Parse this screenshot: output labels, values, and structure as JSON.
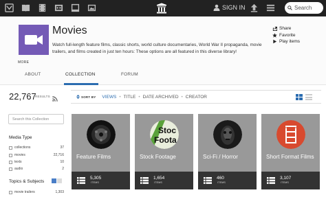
{
  "topnav": {
    "icons": [
      "web-icon",
      "texts-icon",
      "video-icon",
      "audio-icon",
      "software-icon",
      "images-icon"
    ],
    "signin_label": "SIGN IN",
    "search_placeholder": "Search"
  },
  "collection": {
    "title": "Movies",
    "description": "Watch full-length feature films, classic shorts, world culture documentaries, World War II propaganda, movie trailers, and films created in just ten hours: These options are all featured in this diverse library!",
    "more_label": "MORE",
    "icon": "film-camera-icon",
    "icon_color": "#745ab6"
  },
  "actions": [
    {
      "label": "Share",
      "icon": "share-icon"
    },
    {
      "label": "Favorite",
      "icon": "star-icon"
    },
    {
      "label": "Play items",
      "icon": "play-icon"
    }
  ],
  "tabs": [
    {
      "label": "ABOUT"
    },
    {
      "label": "COLLECTION",
      "active": true
    },
    {
      "label": "FORUM"
    }
  ],
  "sidebar": {
    "result_count": "22,767",
    "result_label": "RESULTS",
    "search_placeholder": "Search this Collection",
    "media_type_title": "Media Type",
    "media_types": [
      {
        "label": "collections",
        "count": "37"
      },
      {
        "label": "movies",
        "count": "22,716"
      },
      {
        "label": "texts",
        "count": "10"
      },
      {
        "label": "audio",
        "count": "2"
      }
    ],
    "topics_title": "Topics & Subjects",
    "topics": [
      {
        "label": "movie trailers",
        "count": "1,303"
      }
    ]
  },
  "sortbar": {
    "sort_by_label": "SORT BY",
    "options": [
      "VIEWS",
      "TITLE",
      "DATE ARCHIVED",
      "CREATOR"
    ],
    "active": "VIEWS"
  },
  "cards": [
    {
      "title": "Feature Films",
      "count": "5,305",
      "items_label": "ITEMS"
    },
    {
      "title": "Stock Footage",
      "count": "1,654",
      "items_label": "ITEMS"
    },
    {
      "title": "Sci-Fi / Horror",
      "count": "460",
      "items_label": "ITEMS"
    },
    {
      "title": "Short Format Films",
      "count": "3,107",
      "items_label": "ITEMS"
    }
  ],
  "colors": {
    "topbar": "#222222",
    "accent": "#2b6cb0",
    "card_bg": "#999999",
    "card_footer": "#333333"
  }
}
